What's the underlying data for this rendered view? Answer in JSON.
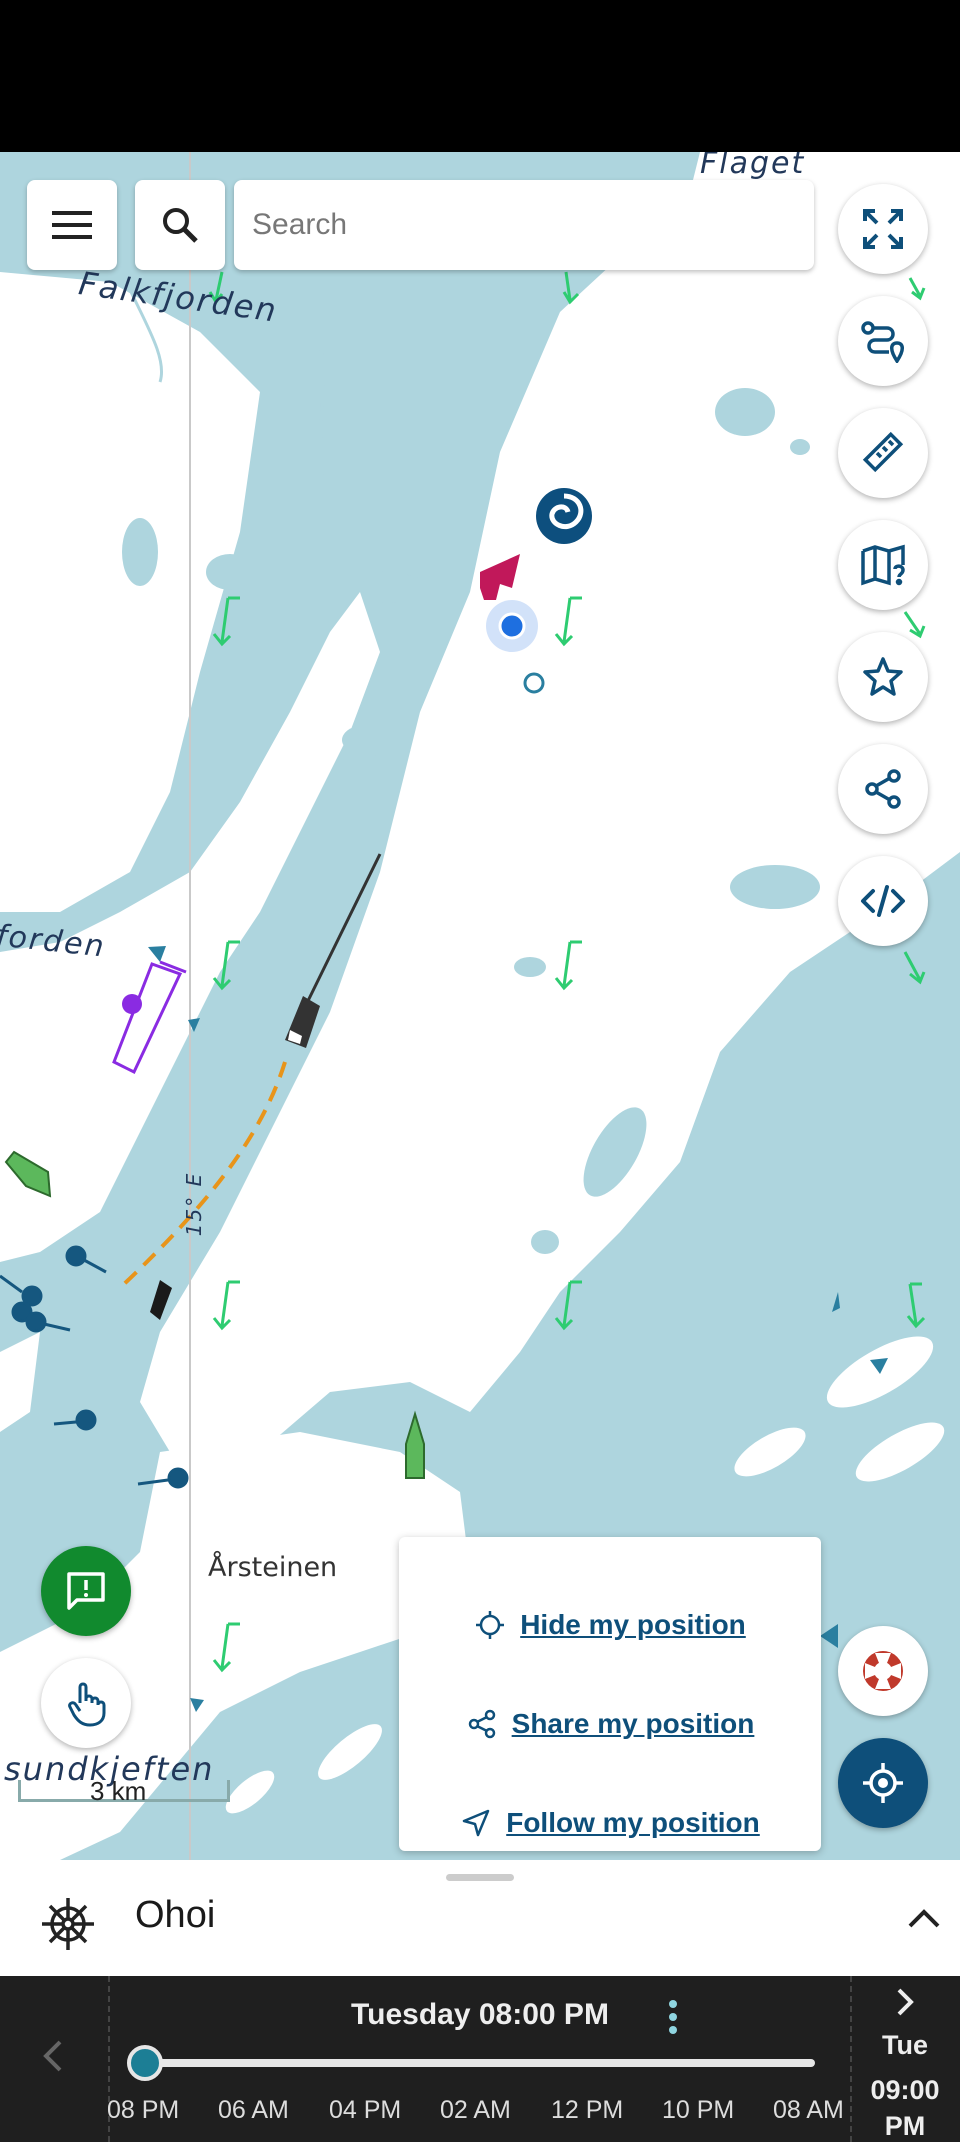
{
  "search": {
    "placeholder": "Search"
  },
  "map": {
    "labels": {
      "flaget": "Flaget",
      "falkfjorden": "Falkfjorden",
      "forden": "forden",
      "longitude": "15° E",
      "arsteinen": "Årsteinen",
      "sundkjeften": "sundkjeften"
    },
    "scale": "3 km"
  },
  "position_menu": {
    "hide": "Hide my position",
    "share": "Share my position",
    "follow": "Follow my position"
  },
  "sheet": {
    "title": "Ohoi"
  },
  "timeline": {
    "current": "Tuesday 08:00 PM",
    "ticks": [
      "08 PM",
      "06 AM",
      "04 PM",
      "02 AM",
      "12 PM",
      "10 PM",
      "08 AM"
    ],
    "next_day": "Tue",
    "next_time": "09:00",
    "next_ampm": "PM",
    "progress": 0.0
  },
  "colors": {
    "water": "#aed5de",
    "land": "#ffffff",
    "accent": "#0e4f7a",
    "current_arrow": "#2ecc71",
    "feedback_button": "#118a2e"
  },
  "icons": [
    "menu-icon",
    "search-icon",
    "fullscreen-icon",
    "route-icon",
    "ruler-icon",
    "map-help-icon",
    "star-icon",
    "share-icon",
    "code-icon",
    "feedback-icon",
    "touch-icon",
    "lifebuoy-icon",
    "locate-icon",
    "helm-icon",
    "chevron-up-icon",
    "chevron-left-icon",
    "chevron-right-icon",
    "more-vert-icon"
  ]
}
